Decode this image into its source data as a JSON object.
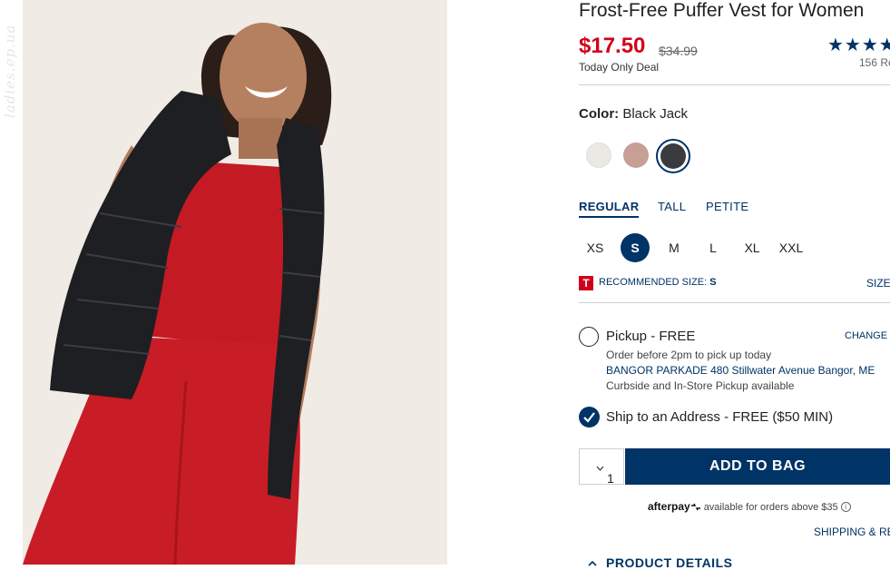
{
  "watermark": "ladies.ep.ua",
  "product": {
    "title": "Frost-Free Puffer Vest for Women",
    "price": "$17.50",
    "original_price": "$34.99",
    "deal_text": "Today Only Deal",
    "rating_stars": "★★★★",
    "review_count": "156 Re"
  },
  "color": {
    "label": "Color:",
    "selected": "Black Jack",
    "swatches": [
      {
        "name": "cream",
        "hex": "#ebe9e4"
      },
      {
        "name": "rose",
        "hex": "#c79f95"
      },
      {
        "name": "black jack",
        "hex": "#3a3b3f"
      }
    ]
  },
  "fit_tabs": [
    {
      "label": "REGULAR",
      "active": true
    },
    {
      "label": "TALL",
      "active": false
    },
    {
      "label": "PETITE",
      "active": false
    }
  ],
  "sizes": [
    "XS",
    "S",
    "M",
    "L",
    "XL",
    "XXL"
  ],
  "selected_size": "S",
  "recommended": {
    "badge": "T",
    "label": "RECOMMENDED SIZE:",
    "value": "S",
    "size_guide": "SIZE"
  },
  "pickup": {
    "label": "Pickup - FREE",
    "change_label": "CHANGE S",
    "order_before": "Order before 2pm to pick up today",
    "store": "BANGOR PARKADE 480 Stillwater Avenue  Bangor, ME",
    "availability": "Curbside and In-Store Pickup available"
  },
  "ship": {
    "label": "Ship to an Address - FREE ($50 MIN)"
  },
  "cart": {
    "quantity": "1",
    "add_to_bag": "ADD TO BAG"
  },
  "afterpay": {
    "brand": "afterpay",
    "text": "available for orders above $35",
    "info": "i"
  },
  "links": {
    "shipping": "SHIPPING & RET",
    "product_details": "PRODUCT DETAILS"
  },
  "colors": {
    "brand_navy": "#003366",
    "sale_red": "#d0021b"
  }
}
